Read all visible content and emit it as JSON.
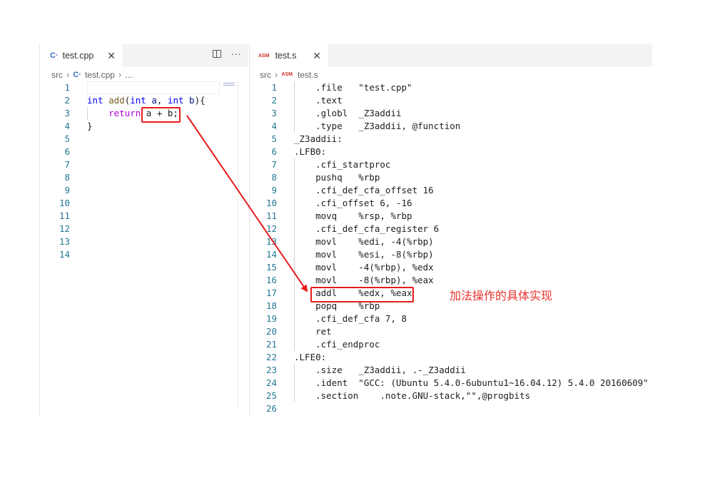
{
  "left_editor": {
    "tab": {
      "icon": "C++",
      "label": "test.cpp",
      "close": "✕"
    },
    "actions": {
      "split": "split-editor",
      "more": "···"
    },
    "breadcrumb": {
      "folder": "src",
      "file": "test.cpp",
      "symbol": "..."
    },
    "line_numbers": [
      "1",
      "2",
      "3",
      "4",
      "5",
      "6",
      "7",
      "8",
      "9",
      "10",
      "11",
      "12",
      "13",
      "14"
    ],
    "code": {
      "l2_kw1": "int",
      "l2_fn": "add",
      "l2_p1": "(",
      "l2_kw2": "int",
      "l2_var1": " a",
      "l2_p2": ", ",
      "l2_kw3": "int",
      "l2_var2": " b",
      "l2_p3": "){",
      "l3_kw": "return",
      "l3_expr": " a + b;",
      "l4": "}"
    }
  },
  "right_editor": {
    "tab": {
      "icon": "ASM",
      "label": "test.s",
      "close": "✕"
    },
    "breadcrumb": {
      "folder": "src",
      "file_icon": "ASM",
      "file": "test.s"
    },
    "line_numbers": [
      "1",
      "2",
      "3",
      "4",
      "5",
      "6",
      "7",
      "8",
      "9",
      "10",
      "11",
      "12",
      "13",
      "14",
      "15",
      "16",
      "17",
      "18",
      "19",
      "20",
      "21",
      "22",
      "23",
      "24",
      "25",
      "26"
    ],
    "lines": [
      "    .file   \"test.cpp\"",
      "    .text",
      "    .globl  _Z3addii",
      "    .type   _Z3addii, @function",
      "_Z3addii:",
      ".LFB0:",
      "    .cfi_startproc",
      "    pushq   %rbp",
      "    .cfi_def_cfa_offset 16",
      "    .cfi_offset 6, -16",
      "    movq    %rsp, %rbp",
      "    .cfi_def_cfa_register 6",
      "    movl    %edi, -4(%rbp)",
      "    movl    %esi, -8(%rbp)",
      "    movl    -4(%rbp), %edx",
      "    movl    -8(%rbp), %eax",
      "    addl    %edx, %eax",
      "    popq    %rbp",
      "    .cfi_def_cfa 7, 8",
      "    ret",
      "    .cfi_endproc",
      ".LFE0:",
      "    .size   _Z3addii, .-_Z3addii",
      "    .ident  \"GCC: (Ubuntu 5.4.0-6ubuntu1~16.04.12) 5.4.0 20160609\"",
      "    .section    .note.GNU-stack,\"\",@progbits",
      ""
    ]
  },
  "annotation": {
    "text": "加法操作的具体实现"
  },
  "colors": {
    "line_number": "#237893",
    "keyword": "#0000ff",
    "control_keyword": "#af00db",
    "function": "#795e26",
    "highlight": "#e81b1b",
    "annotation": "#e8322b"
  }
}
